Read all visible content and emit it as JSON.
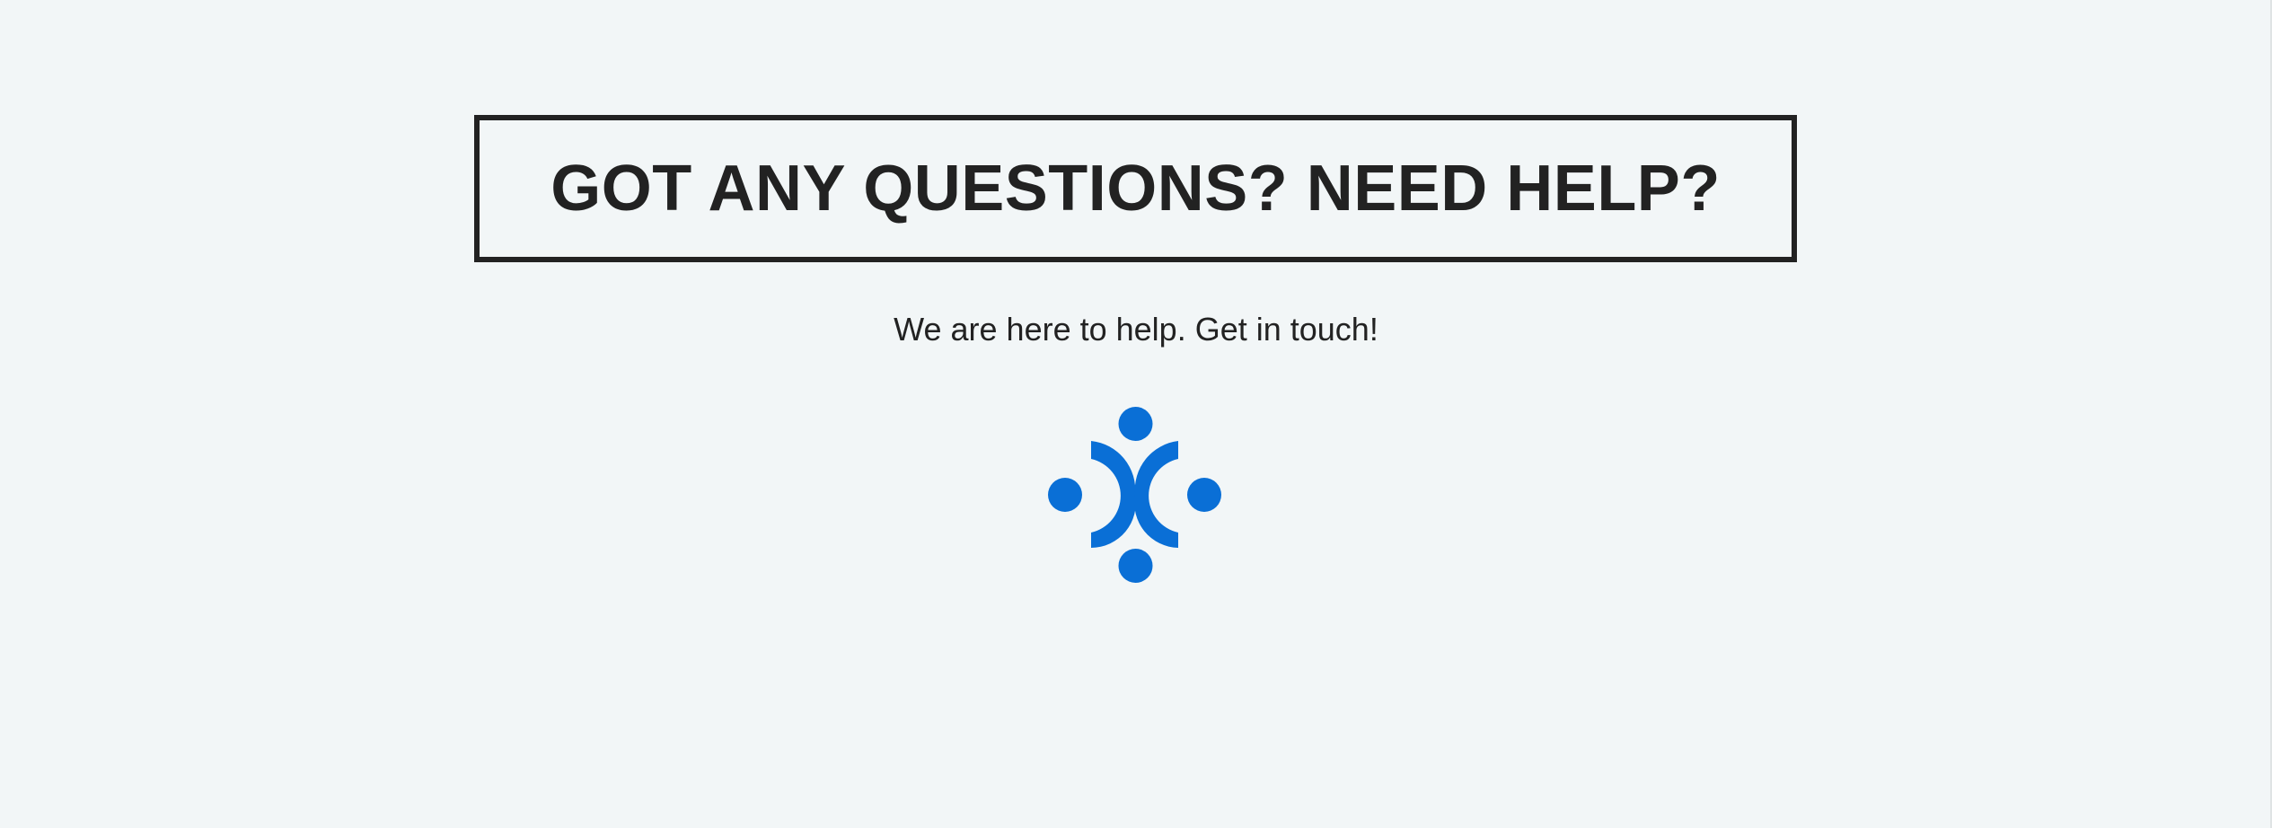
{
  "heading": {
    "title": "GOT ANY QUESTIONS? NEED HELP?"
  },
  "subtitle": "We are here to help. Get in touch!",
  "logo": {
    "icon": "support-logo-icon",
    "color": "#0a6fd6"
  },
  "colors": {
    "background": "#f2f6f7",
    "text": "#222222",
    "accent": "#0a6fd6"
  }
}
